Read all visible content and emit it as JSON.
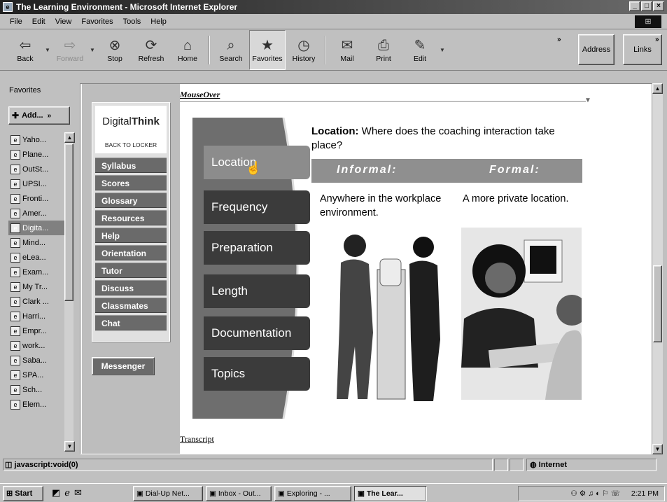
{
  "window": {
    "title": "The Learning Environment - Microsoft Internet Explorer",
    "controls": [
      "_",
      "□",
      "×"
    ]
  },
  "menu": [
    "File",
    "Edit",
    "View",
    "Favorites",
    "Tools",
    "Help"
  ],
  "toolbar": {
    "buttons": [
      {
        "label": "Back",
        "icon": "back-arrow-icon",
        "glyph": "⇦"
      },
      {
        "label": "Forward",
        "icon": "forward-arrow-icon",
        "glyph": "⇨",
        "disabled": true
      },
      {
        "label": "Stop",
        "icon": "stop-icon",
        "glyph": "⊗"
      },
      {
        "label": "Refresh",
        "icon": "refresh-icon",
        "glyph": "⟳"
      },
      {
        "label": "Home",
        "icon": "home-icon",
        "glyph": "⌂"
      },
      {
        "label": "Search",
        "icon": "search-icon",
        "glyph": "🔍"
      },
      {
        "label": "Favorites",
        "icon": "favorites-icon",
        "glyph": "★",
        "pressed": true
      },
      {
        "label": "History",
        "icon": "history-icon",
        "glyph": "⏲"
      },
      {
        "label": "Mail",
        "icon": "mail-icon",
        "glyph": "✉"
      },
      {
        "label": "Print",
        "icon": "print-icon",
        "glyph": "⎙"
      },
      {
        "label": "Edit",
        "icon": "edit-icon",
        "glyph": "✎"
      }
    ],
    "address": "Address",
    "links": "Links"
  },
  "favorites": {
    "header": "Favorites",
    "add": "Add...",
    "items": [
      "Yaho...",
      "Plane...",
      "OutSt...",
      "UPSI...",
      "Fronti...",
      "Amer...",
      "Digita...",
      "Mind...",
      "eLea...",
      "Exam...",
      "My Tr...",
      "Clark ...",
      "Harri...",
      "Empr...",
      "work...",
      "Saba...",
      "SPA...",
      "Sch...",
      "Elem..."
    ],
    "selected_index": 6
  },
  "site": {
    "logo_plain": "Digital",
    "logo_bold": "Think",
    "back_to_locker": "BACK TO LOCKER",
    "nav": [
      "Syllabus",
      "Scores",
      "Glossary",
      "Resources",
      "Help",
      "Orientation",
      "Tutor",
      "Discuss",
      "Classmates",
      "Chat"
    ],
    "messenger": "Messenger"
  },
  "lesson": {
    "mouseover": "MouseOver",
    "tabs": [
      "Location",
      "Frequency",
      "Preparation",
      "Length",
      "Documentation",
      "Topics"
    ],
    "active_tab": 0,
    "heading_bold": "Location:",
    "heading_text": "Where does the coaching interaction take place?",
    "informal": "Informal:",
    "formal": "Formal:",
    "informal_desc": "Anywhere in the workplace environment.",
    "formal_desc": "A more private location.",
    "transcript": "Transcript"
  },
  "status": {
    "text": "javascript:void(0)",
    "zone": "Internet"
  },
  "taskbar": {
    "start": "Start",
    "tasks": [
      "Dial-Up Net...",
      "Inbox - Out...",
      "Exploring - ...",
      "The Lear..."
    ],
    "active_task": 3,
    "clock": "2:21 PM"
  }
}
